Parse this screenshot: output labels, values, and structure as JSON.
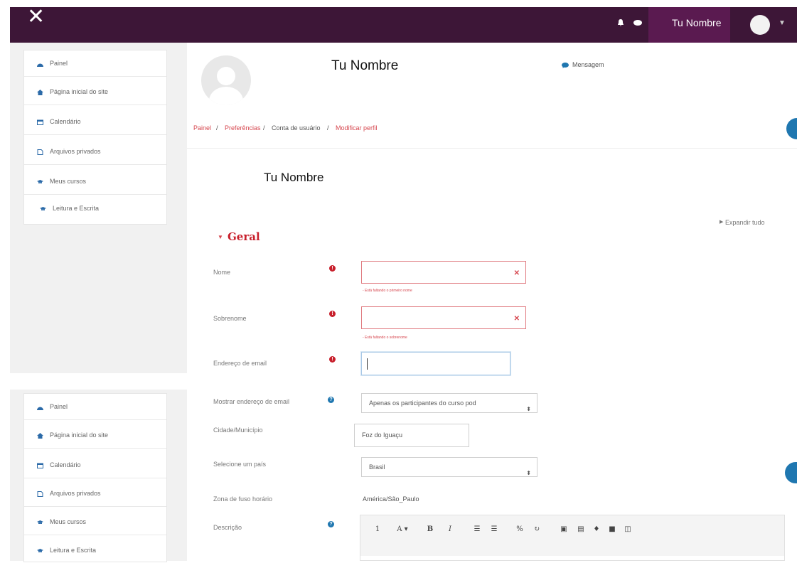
{
  "topbar": {
    "user_name": "Tu Nombre"
  },
  "sidebar": {
    "items": [
      {
        "label": "Painel",
        "icon": "dashboard-icon"
      },
      {
        "label": "Página inicial do site",
        "icon": "home-icon"
      },
      {
        "label": "Calendário",
        "icon": "calendar-icon"
      },
      {
        "label": "Arquivos privados",
        "icon": "file-icon"
      },
      {
        "label": "Meus cursos",
        "icon": "graduation-cap-icon"
      },
      {
        "label": "Leitura e Escrita",
        "icon": "graduation-cap-icon"
      }
    ]
  },
  "header": {
    "user_name": "Tu Nombre",
    "message_label": "Mensagem",
    "breadcrumb": [
      "Painel",
      "Preferências",
      "Conta de usuário",
      "Modificar perfil"
    ]
  },
  "form": {
    "title": "Tu Nombre",
    "expand_all": "Expandir tudo",
    "section_title": "Geral",
    "fields": {
      "first_name": {
        "label": "Nome",
        "value": "",
        "error": "- Está faltando o primeiro nome"
      },
      "last_name": {
        "label": "Sobrenome",
        "value": "",
        "error": "- Está faltando o sobrenome"
      },
      "email": {
        "label": "Endereço de email",
        "value": ""
      },
      "show_email": {
        "label": "Mostrar endereço de email",
        "value": "Apenas os participantes do curso pod"
      },
      "city": {
        "label": "Cidade/Município",
        "value": "Foz do Iguaçu"
      },
      "country": {
        "label": "Selecione um país",
        "value": "Brasil"
      },
      "timezone": {
        "label": "Zona de fuso horário",
        "value": "América/São_Paulo"
      },
      "description": {
        "label": "Descrição"
      }
    },
    "toolbar_glyphs": [
      "1",
      "A ▾",
      "B",
      "I"
    ]
  },
  "colors": {
    "topbar": "#3d1637",
    "accent": "#d6464e",
    "info": "#1f77b0"
  }
}
